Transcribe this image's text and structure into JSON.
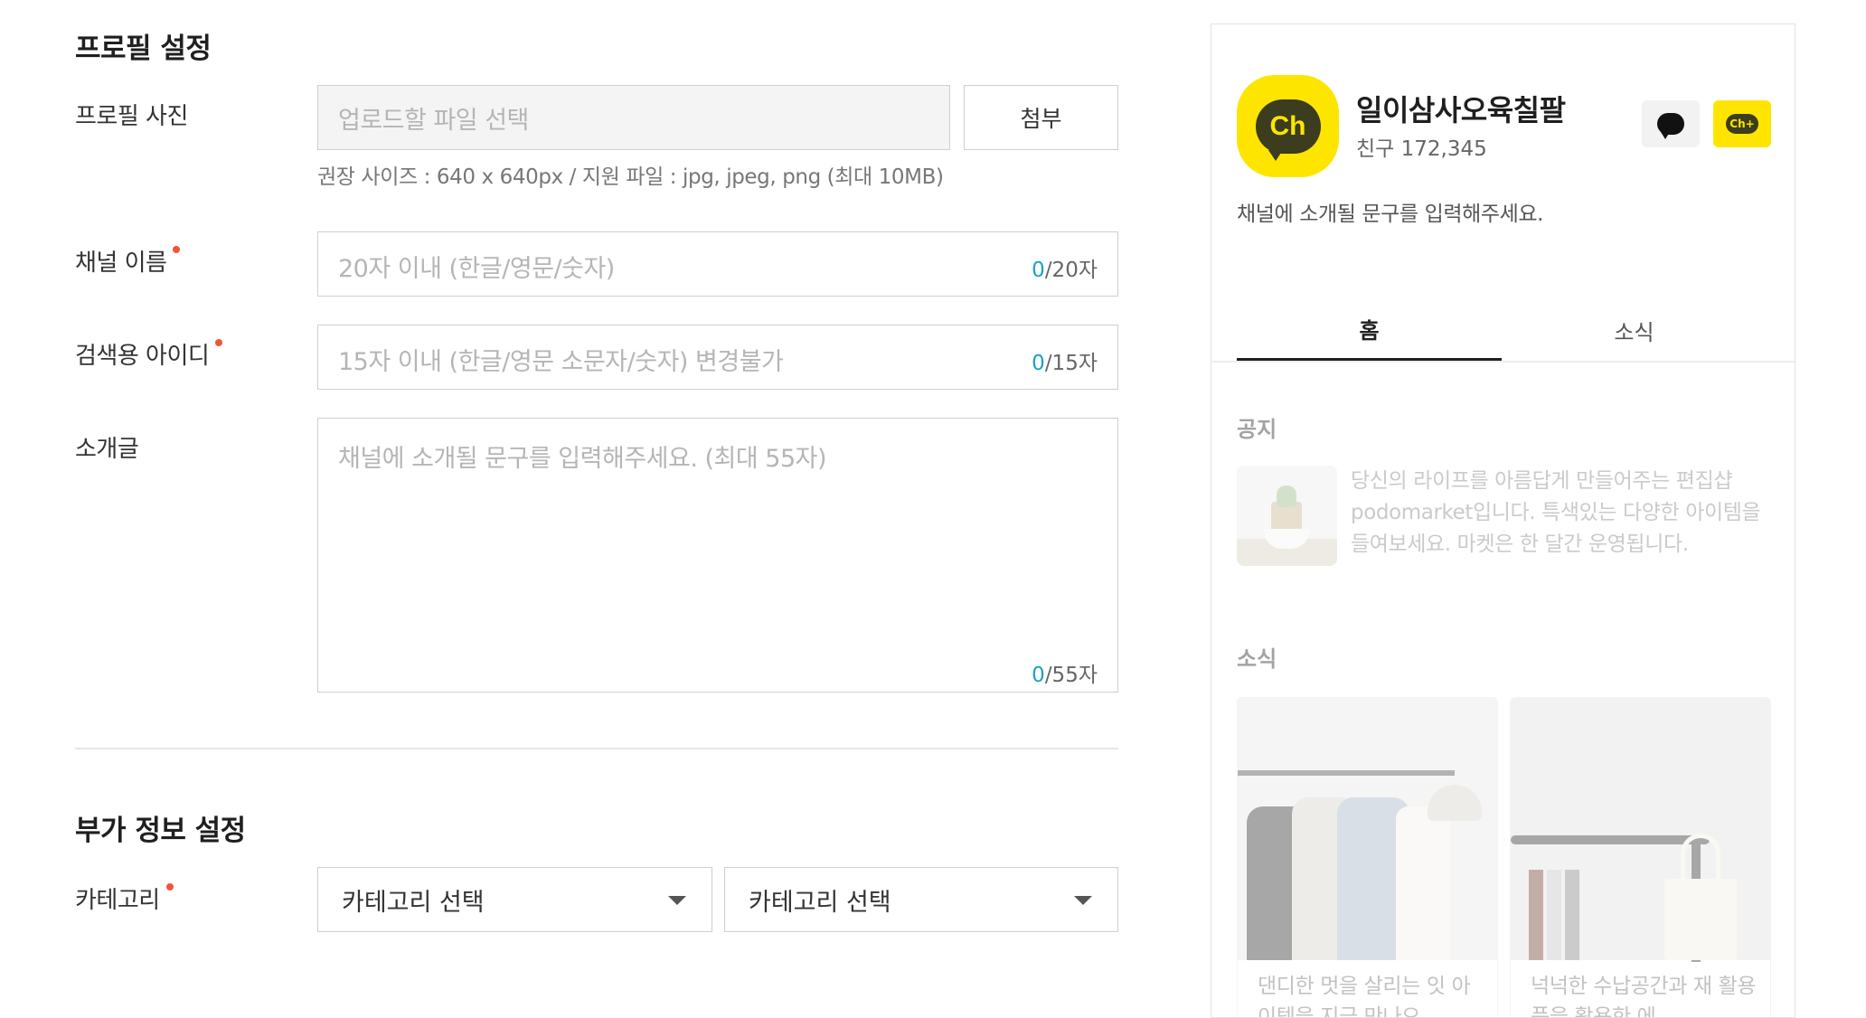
{
  "profile_section": {
    "title": "프로필 설정",
    "photo": {
      "label": "프로필 사진",
      "placeholder": "업로드할 파일 선택",
      "attach_label": "첨부",
      "hint": "권장 사이즈 : 640 x 640px / 지원 파일 : jpg, jpeg, png (최대 10MB)"
    },
    "channel_name": {
      "label": "채널 이름",
      "placeholder": "20자 이내 (한글/영문/숫자)",
      "count": "0",
      "max": "/20자"
    },
    "search_id": {
      "label": "검색용 아이디",
      "placeholder": "15자 이내 (한글/영문 소문자/숫자) 변경불가",
      "count": "0",
      "max": "/15자"
    },
    "intro": {
      "label": "소개글",
      "placeholder": "채널에 소개될 문구를 입력해주세요. (최대 55자)",
      "count": "0",
      "max": "/55자"
    }
  },
  "extra_section": {
    "title": "부가 정보 설정",
    "category": {
      "label": "카테고리",
      "select1": "카테고리 선택",
      "select2": "카테고리 선택"
    }
  },
  "preview": {
    "logo_text": "Ch",
    "channel_name": "일이삼사오육칠팔",
    "friends": "친구 172,345",
    "intro": "채널에 소개될 문구를 입력해주세요.",
    "tabs": [
      {
        "label": "홈",
        "active": true
      },
      {
        "label": "소식",
        "active": false
      }
    ],
    "notice_title": "공지",
    "notice_text": "당신의 라이프를 아름답게 만들어주는 편집샵 podomarket입니다. 특색있는 다양한 아이템을 들여보세요. 마켓은 한 달간 운영됩니다.",
    "news_title": "소식",
    "news_items": [
      {
        "text": "댄디한 멋을 살리는 잇 아이템을 지금 만나오"
      },
      {
        "text": "넉넉한 수납공간과 재 활용품을 활용한 에"
      }
    ],
    "add_logo_text": "Ch+"
  },
  "colors": {
    "kakao_yellow": "#fee500",
    "required_dot": "#f2543a",
    "counter_accent": "#1aa1c9"
  }
}
